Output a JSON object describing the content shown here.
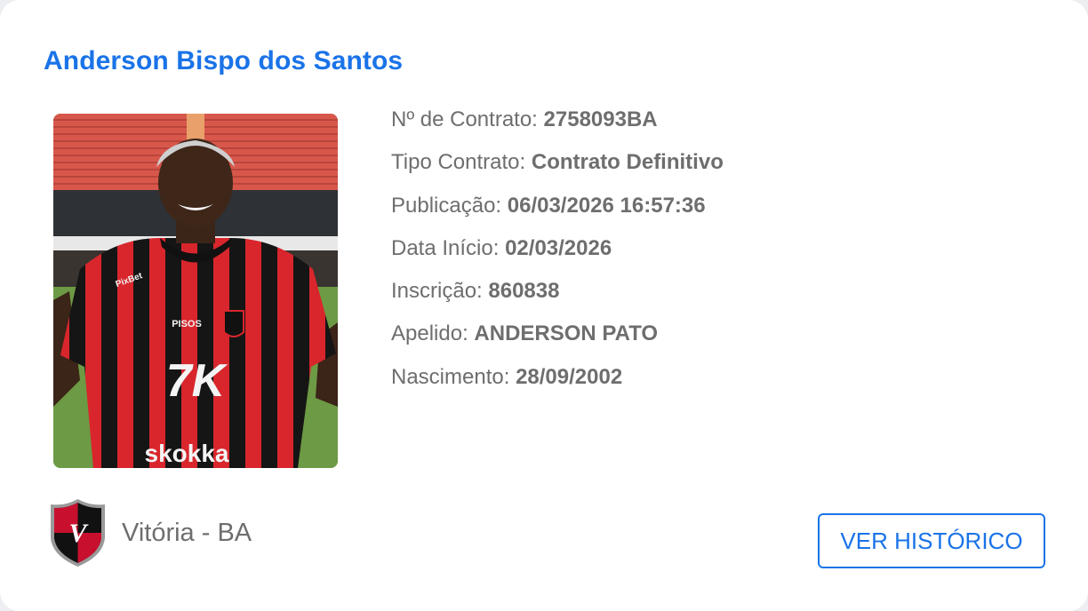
{
  "player": {
    "name": "Anderson Bispo dos Santos"
  },
  "details": [
    {
      "label": "Nº de Contrato:",
      "value": "2758093BA"
    },
    {
      "label": "Tipo Contrato:",
      "value": "Contrato Definitivo"
    },
    {
      "label": "Publicação:",
      "value": "06/03/2026 16:57:36"
    },
    {
      "label": "Data Início:",
      "value": "02/03/2026"
    },
    {
      "label": "Inscrição:",
      "value": "860838"
    },
    {
      "label": "Apelido:",
      "value": "ANDERSON PATO"
    },
    {
      "label": "Nascimento:",
      "value": "28/09/2002"
    }
  ],
  "club": {
    "name": "Vitória - BA",
    "crest_icon": "club-crest-icon",
    "colors": {
      "red": "#c8102e",
      "black": "#111111"
    }
  },
  "actions": {
    "history_label": "VER HISTÓRICO"
  },
  "photo_text": {
    "sponsor": "7K",
    "sponsor_bottom": "skokka",
    "shoulder_sponsor": "PixBet",
    "chest_sponsor": "PISOS"
  },
  "theme": {
    "accent": "#1a73e8",
    "text_gray": "#6e6e6e",
    "card_bg": "#ffffff"
  }
}
